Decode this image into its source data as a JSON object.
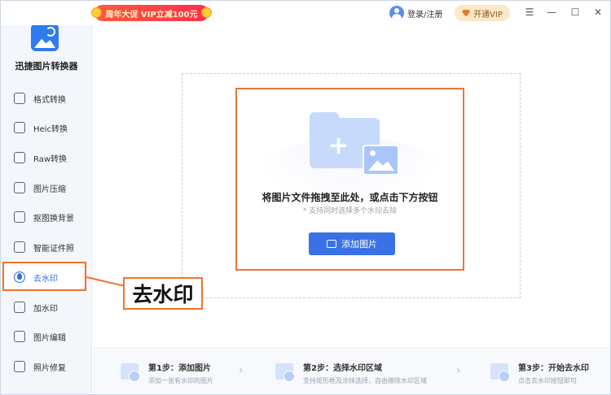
{
  "titlebar": {
    "promo": "周年大促 VIP立减100元",
    "login": "登录/注册",
    "vip": "开通VIP",
    "controls": [
      "☰",
      "—",
      "☐",
      "✕"
    ]
  },
  "app": {
    "name": "迅捷图片转换器"
  },
  "sidebar": {
    "items": [
      {
        "label": "格式转换"
      },
      {
        "label": "Heic转换"
      },
      {
        "label": "Raw转换"
      },
      {
        "label": "图片压缩"
      },
      {
        "label": "抠图换背景"
      },
      {
        "label": "智能证件照"
      },
      {
        "label": "去水印"
      },
      {
        "label": "加水印"
      },
      {
        "label": "图片编辑"
      },
      {
        "label": "照片修复"
      }
    ],
    "active_index": 6
  },
  "main": {
    "prompt": "将图片文件拖拽至此处，或点击下方按钮",
    "hint": "* 支持同时选择多个水印去除",
    "add_button": "添加图片"
  },
  "steps": [
    {
      "title": "第1步：添加图片",
      "desc": "添加一张有水印的图片"
    },
    {
      "title": "第2步：选择水印区域",
      "desc": "支持矩形框及涂抹选择，自由擦除水印区域"
    },
    {
      "title": "第3步：开始去水印",
      "desc": "点击去水印按钮即可"
    }
  ],
  "annotation": {
    "callout": "去水印"
  },
  "colors": {
    "accent": "#3a72e5",
    "highlight": "#f4722b",
    "sidebar_bg": "#f3f6fb"
  }
}
